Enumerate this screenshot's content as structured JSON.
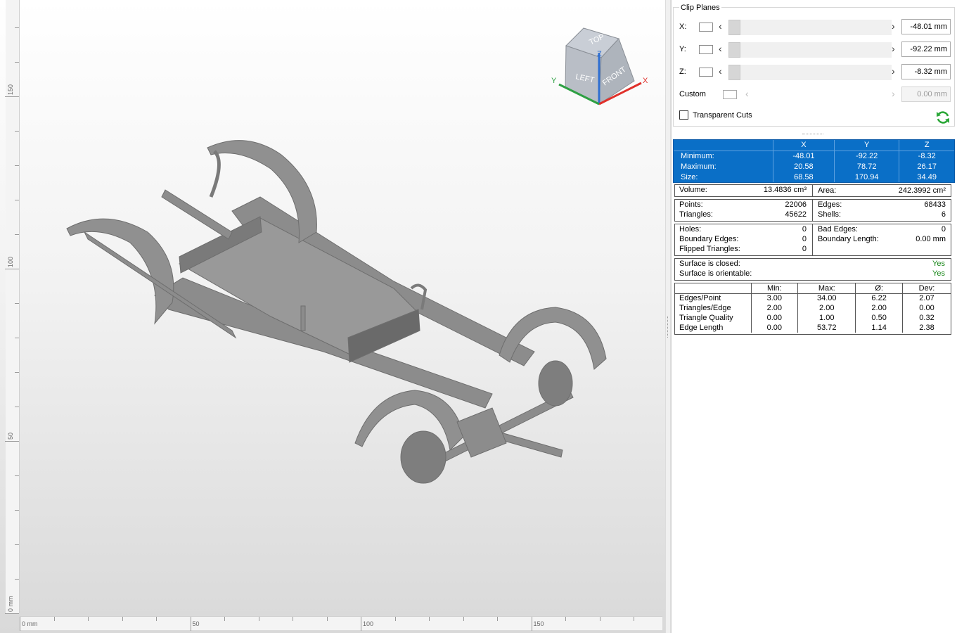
{
  "viewport": {
    "ruler_vertical": [
      {
        "label": "150",
        "value": 150
      },
      {
        "label": "100",
        "value": 100
      },
      {
        "label": "50",
        "value": 50
      },
      {
        "label": "0 mm",
        "value": 0
      }
    ],
    "ruler_horizontal": [
      {
        "label": "0 mm",
        "value": 0
      },
      {
        "label": "50",
        "value": 50
      },
      {
        "label": "100",
        "value": 100
      },
      {
        "label": "150",
        "value": 150
      }
    ],
    "viewcube": {
      "faces": {
        "top": "TOP",
        "left": "LEFT",
        "front": "FRONT"
      },
      "axes": {
        "x": "X",
        "y": "Y",
        "z": "Z"
      },
      "colors": {
        "x": "#e0302a",
        "y": "#2ea043",
        "z": "#2f6fd1"
      }
    },
    "model_color": "#8c8c8c"
  },
  "clip_planes": {
    "title": "Clip Planes",
    "rows": [
      {
        "label": "X:",
        "value": "-48.01 mm",
        "enabled": true
      },
      {
        "label": "Y:",
        "value": "-92.22 mm",
        "enabled": true
      },
      {
        "label": "Z:",
        "value": "-8.32 mm",
        "enabled": true
      },
      {
        "label": "Custom",
        "value": "0.00 mm",
        "enabled": false
      }
    ],
    "transparent_cuts_label": "Transparent Cuts",
    "transparent_cuts_checked": false,
    "refresh_icon": "refresh-icon",
    "refresh_color": "#2da83a"
  },
  "bounding_box": {
    "headers": [
      "X",
      "Y",
      "Z"
    ],
    "rows": [
      {
        "label": "Minimum:",
        "values": [
          "-48.01",
          "-92.22",
          "-8.32"
        ]
      },
      {
        "label": "Maximum:",
        "values": [
          "20.58",
          "78.72",
          "26.17"
        ]
      },
      {
        "label": "Size:",
        "values": [
          "68.58",
          "170.94",
          "34.49"
        ]
      }
    ],
    "highlight_color": "#0a6fc7"
  },
  "volume": {
    "label": "Volume:",
    "value": "13.4836 cm³"
  },
  "area": {
    "label": "Area:",
    "value": "242.3992 cm²"
  },
  "counts": {
    "points_label": "Points:",
    "points": "22006",
    "triangles_label": "Triangles:",
    "triangles": "45622",
    "edges_label": "Edges:",
    "edges": "68433",
    "shells_label": "Shells:",
    "shells": "6"
  },
  "errors": {
    "holes_label": "Holes:",
    "holes": "0",
    "boundary_edges_label": "Boundary Edges:",
    "boundary_edges": "0",
    "flipped_label": "Flipped Triangles:",
    "flipped": "0",
    "bad_edges_label": "Bad Edges:",
    "bad_edges": "0",
    "boundary_length_label": "Boundary Length:",
    "boundary_length": "0.00 mm"
  },
  "surface": {
    "closed_label": "Surface is closed:",
    "closed": "Yes",
    "orientable_label": "Surface is orientable:",
    "orientable": "Yes"
  },
  "metrics": {
    "headers": [
      "Min:",
      "Max:",
      "Ø:",
      "Dev:"
    ],
    "rows": [
      {
        "label": "Edges/Point",
        "values": [
          "3.00",
          "34.00",
          "6.22",
          "2.07"
        ]
      },
      {
        "label": "Triangles/Edge",
        "values": [
          "2.00",
          "2.00",
          "2.00",
          "0.00"
        ]
      },
      {
        "label": "Triangle Quality",
        "values": [
          "0.00",
          "1.00",
          "0.50",
          "0.32"
        ]
      },
      {
        "label": "Edge Length",
        "values": [
          "0.00",
          "53.72",
          "1.14",
          "2.38"
        ]
      }
    ]
  }
}
